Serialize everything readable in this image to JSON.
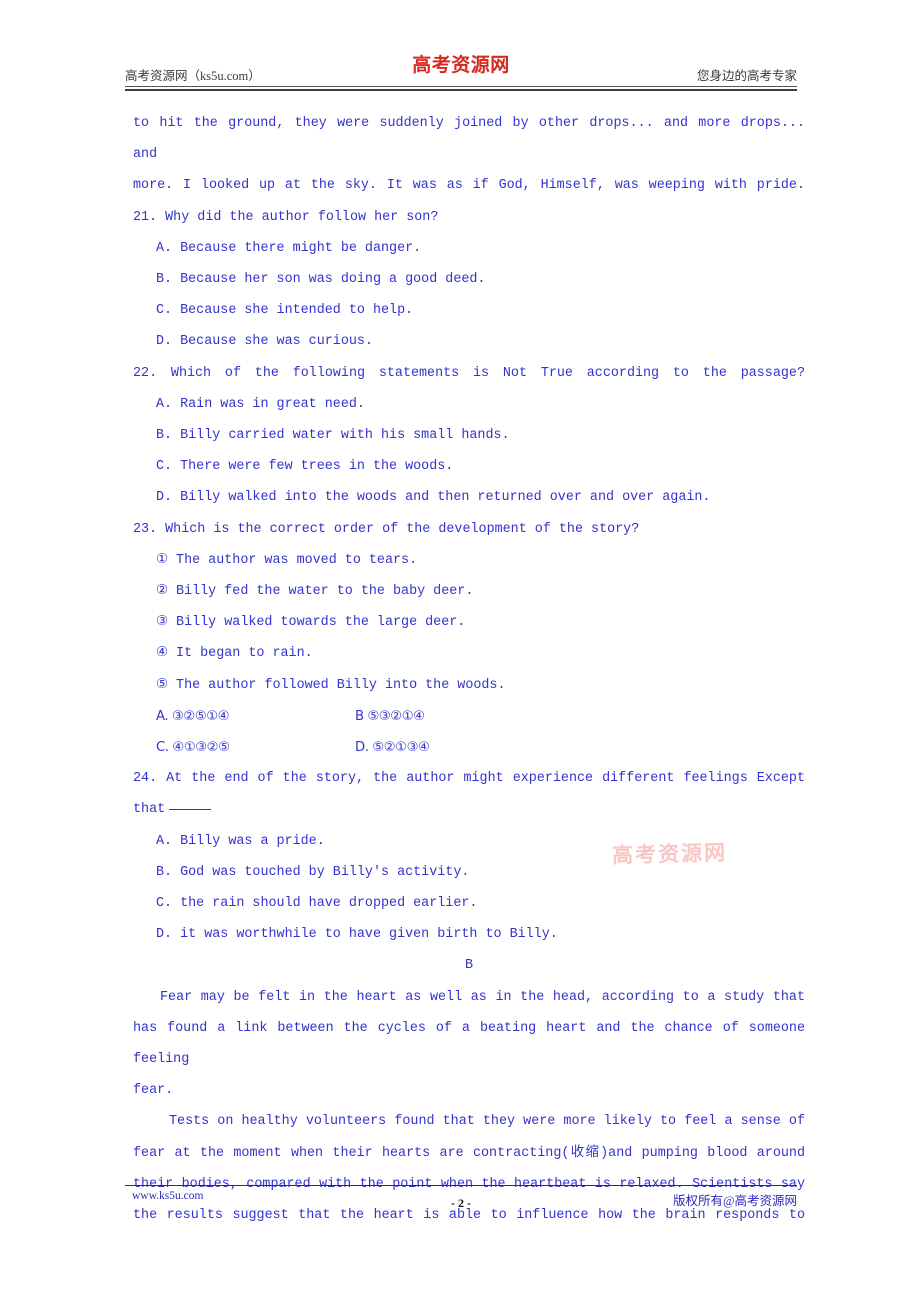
{
  "header": {
    "left_text": "高考资源网（ks5u.com）",
    "logo_text": "高考资源网",
    "right_text": "您身边的高考专家"
  },
  "watermark": {
    "text": "高考资源网"
  },
  "footer": {
    "left_text": "www.ks5u.com",
    "page_number": "- 2 -",
    "right_text": "版权所有@高考资源网"
  },
  "body": {
    "passage_a_tail": [
      "to hit the ground, they were suddenly joined by other drops... and more drops... and",
      "more. I looked up at the sky. It was as if God, Himself, was weeping with pride."
    ],
    "q21": {
      "stem": "21. Why did the author follow her son?",
      "options": [
        "A. Because there might be danger.",
        "B. Because her son was doing a good deed.",
        "C. Because she intended to help.",
        "D. Because she was curious."
      ]
    },
    "q22": {
      "stem": "22. Which of the following statements is Not True according to the passage?",
      "options": [
        "A. Rain was in great need.",
        "B. Billy carried water with his small hands.",
        "C. There were few trees in the woods.",
        "D. Billy walked into the woods and then returned over and over again."
      ]
    },
    "q23": {
      "stem": "23. Which is the correct order of the development of the story?",
      "events": [
        "① The author was moved to tears.",
        "② Billy fed the water to the baby deer.",
        "③ Billy walked towards the large deer.",
        "④ It began to rain.",
        "⑤ The author followed Billy into the woods."
      ],
      "answers": {
        "a": "A. ③②⑤①④",
        "b": "B ⑤③②①④",
        "c": "C. ④①③②⑤",
        "d": "D. ⑤②①③④"
      }
    },
    "q24": {
      "stem_line1": "24. At the end of the story, the author might experience different feelings Except",
      "stem_line2": "that",
      "options": [
        "A. Billy was a pride.",
        "B. God was touched by Billy's activity.",
        "C. the rain should have dropped earlier.",
        "D. it was worthwhile to have given birth to Billy."
      ]
    },
    "section_b": {
      "label": "B",
      "para1": [
        "Fear may be felt in the heart as well as in the head, according to a study that",
        "has found a link between the cycles of a beating heart and the chance of someone feeling",
        "fear."
      ],
      "para2": [
        "Tests on healthy volunteers found that they were more likely to feel a sense of",
        "fear at the moment when their hearts are contracting(收缩)and pumping blood around",
        "their bodies, compared with the point when the heartbeat is relaxed. Scientists say",
        "the results suggest that the heart is able to influence how the brain responds to"
      ]
    }
  }
}
